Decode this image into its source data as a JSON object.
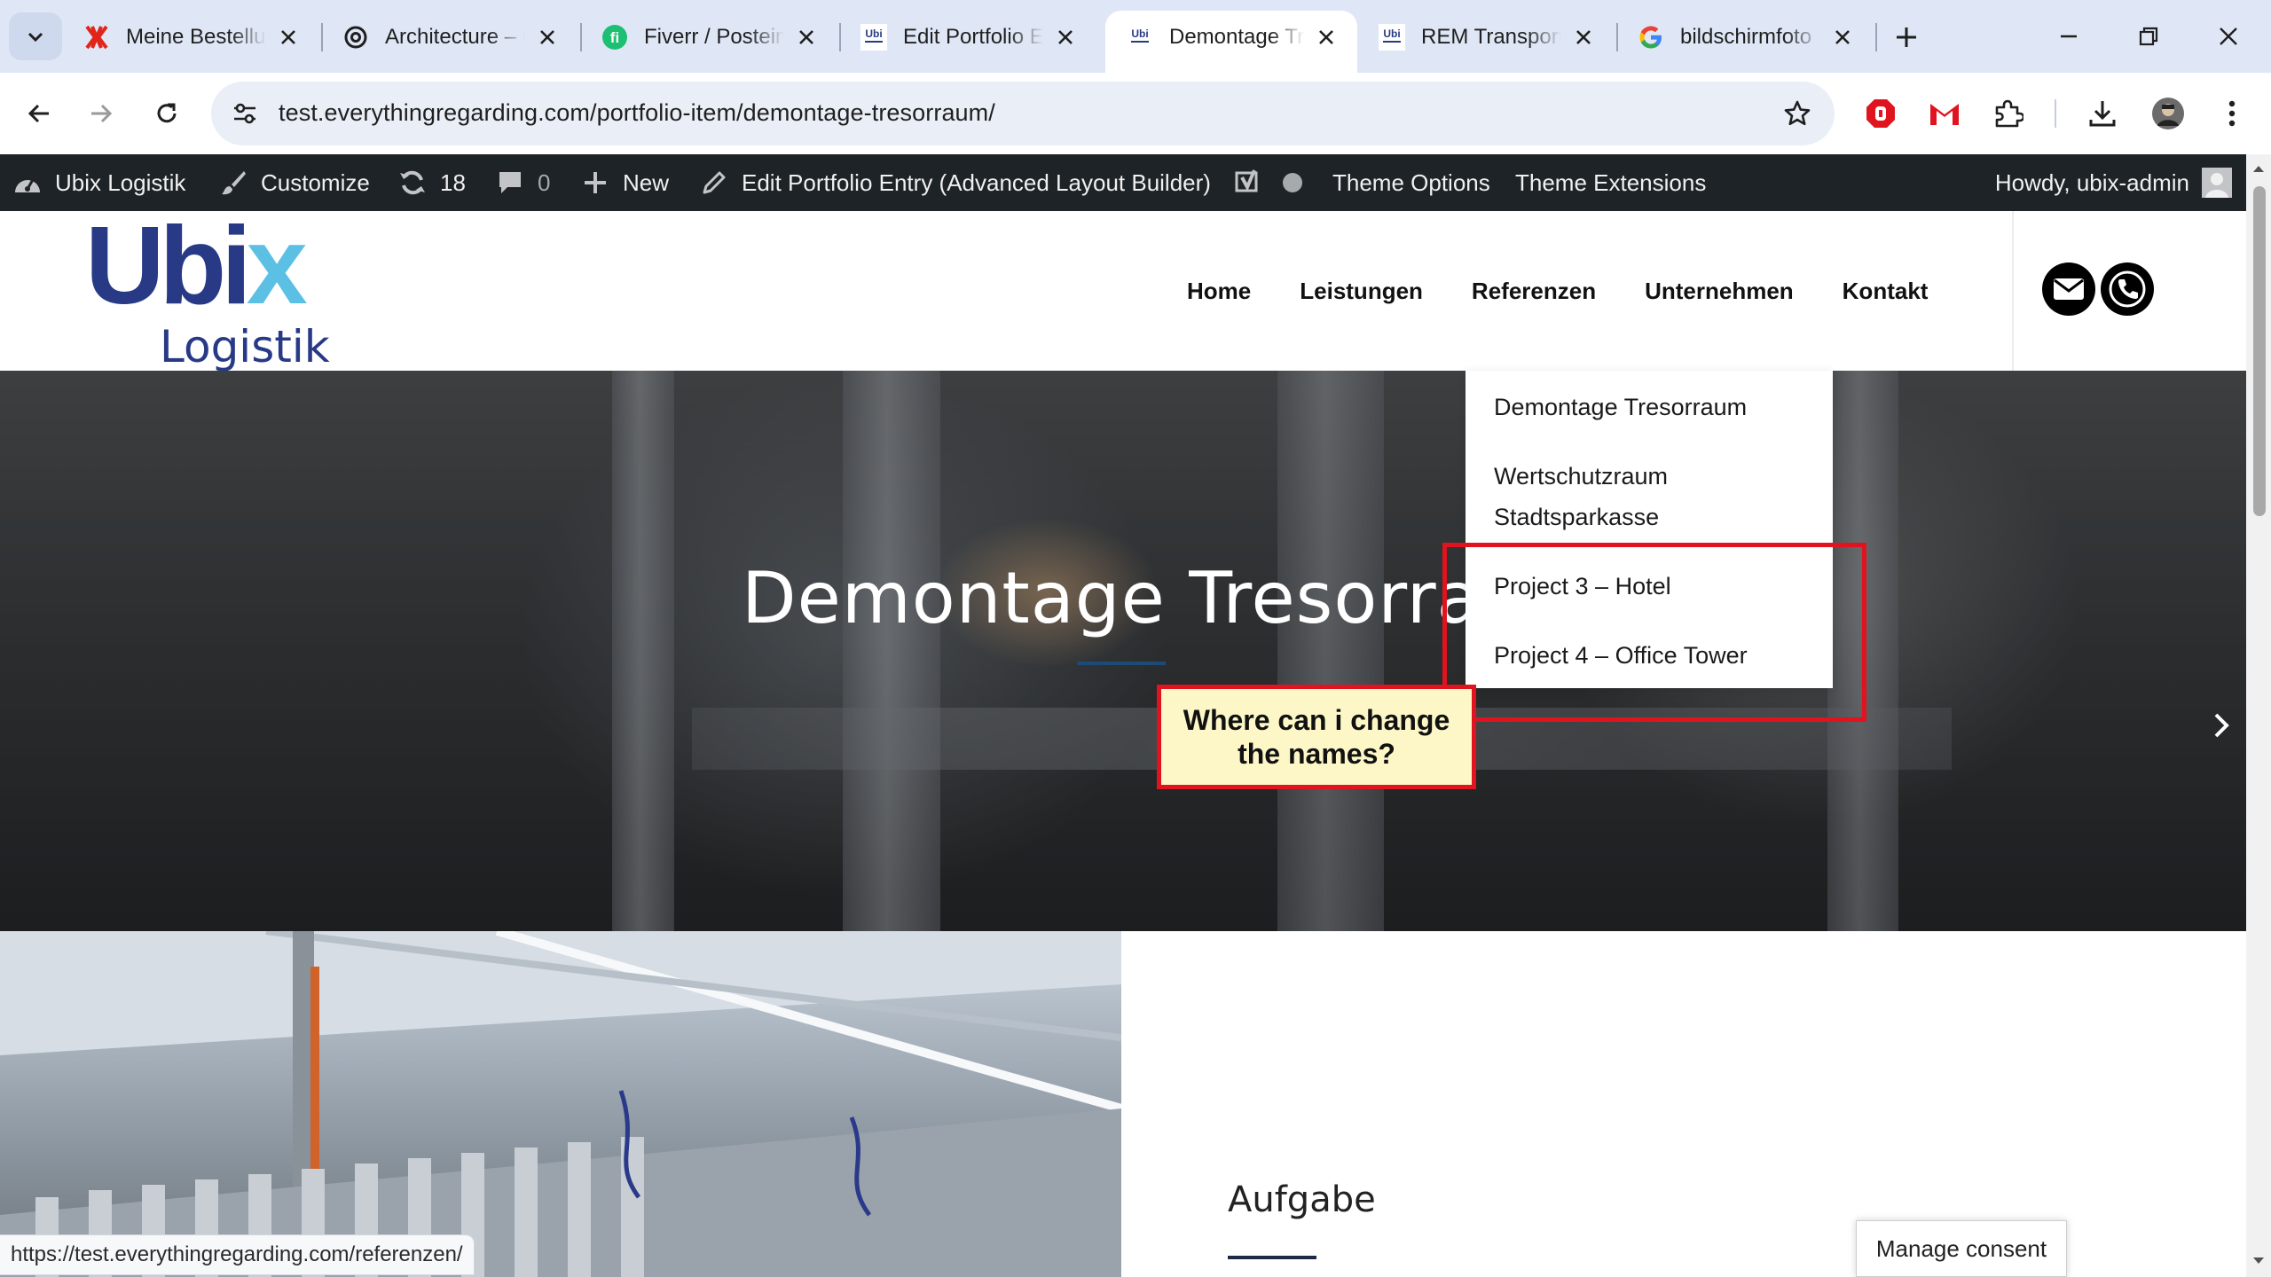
{
  "browser": {
    "tabs": [
      {
        "title": "Meine Bestellungen",
        "icon": "x-brand-icon",
        "active": false
      },
      {
        "title": "Architecture – ChatGPT",
        "icon": "openai-icon",
        "active": false
      },
      {
        "title": "Fiverr / Posteingang",
        "icon": "fiverr-icon",
        "active": false
      },
      {
        "title": "Edit Portfolio Entry",
        "icon": "ubix-favicon",
        "active": false
      },
      {
        "title": "Demontage Tresorraum",
        "icon": "ubix-favicon",
        "active": true
      },
      {
        "title": "REM Transport",
        "icon": "ubix-favicon",
        "active": false
      },
      {
        "title": "bildschirmfoto",
        "icon": "google-icon",
        "active": false
      }
    ],
    "url": "test.everythingregarding.com/portfolio-item/demontage-tresorraum/",
    "status_url": "https://test.everythingregarding.com/referenzen/"
  },
  "adminbar": {
    "site_name": "Ubix Logistik",
    "customize": "Customize",
    "updates_count": "18",
    "comments_count": "0",
    "new_label": "New",
    "edit_label": "Edit Portfolio Entry (Advanced Layout Builder)",
    "theme_options": "Theme Options",
    "theme_extensions": "Theme Extensions",
    "howdy": "Howdy, ubix-admin"
  },
  "site": {
    "logo_part1": "Ubi",
    "logo_part2": "x",
    "logo_sub": "Logistik",
    "nav": [
      "Home",
      "Leistungen",
      "Referenzen",
      "Unternehmen",
      "Kontakt"
    ],
    "submenu": [
      "Demontage Tresorraum",
      "Wertschutzraum Stadtsparkasse",
      "Project 3 – Hotel",
      "Project 4 – Office Tower"
    ],
    "hero_title": "Demontage Tresorraum",
    "section_heading": "Aufgabe",
    "consent_button": "Manage consent"
  },
  "annotation": {
    "note": "Where can i change the names?"
  },
  "colors": {
    "accent_red": "#e0141e",
    "note_bg": "#fdf7c7",
    "logo_navy": "#283a86",
    "logo_cyan": "#5cc0e4",
    "adminbar_bg": "#1d2327"
  }
}
